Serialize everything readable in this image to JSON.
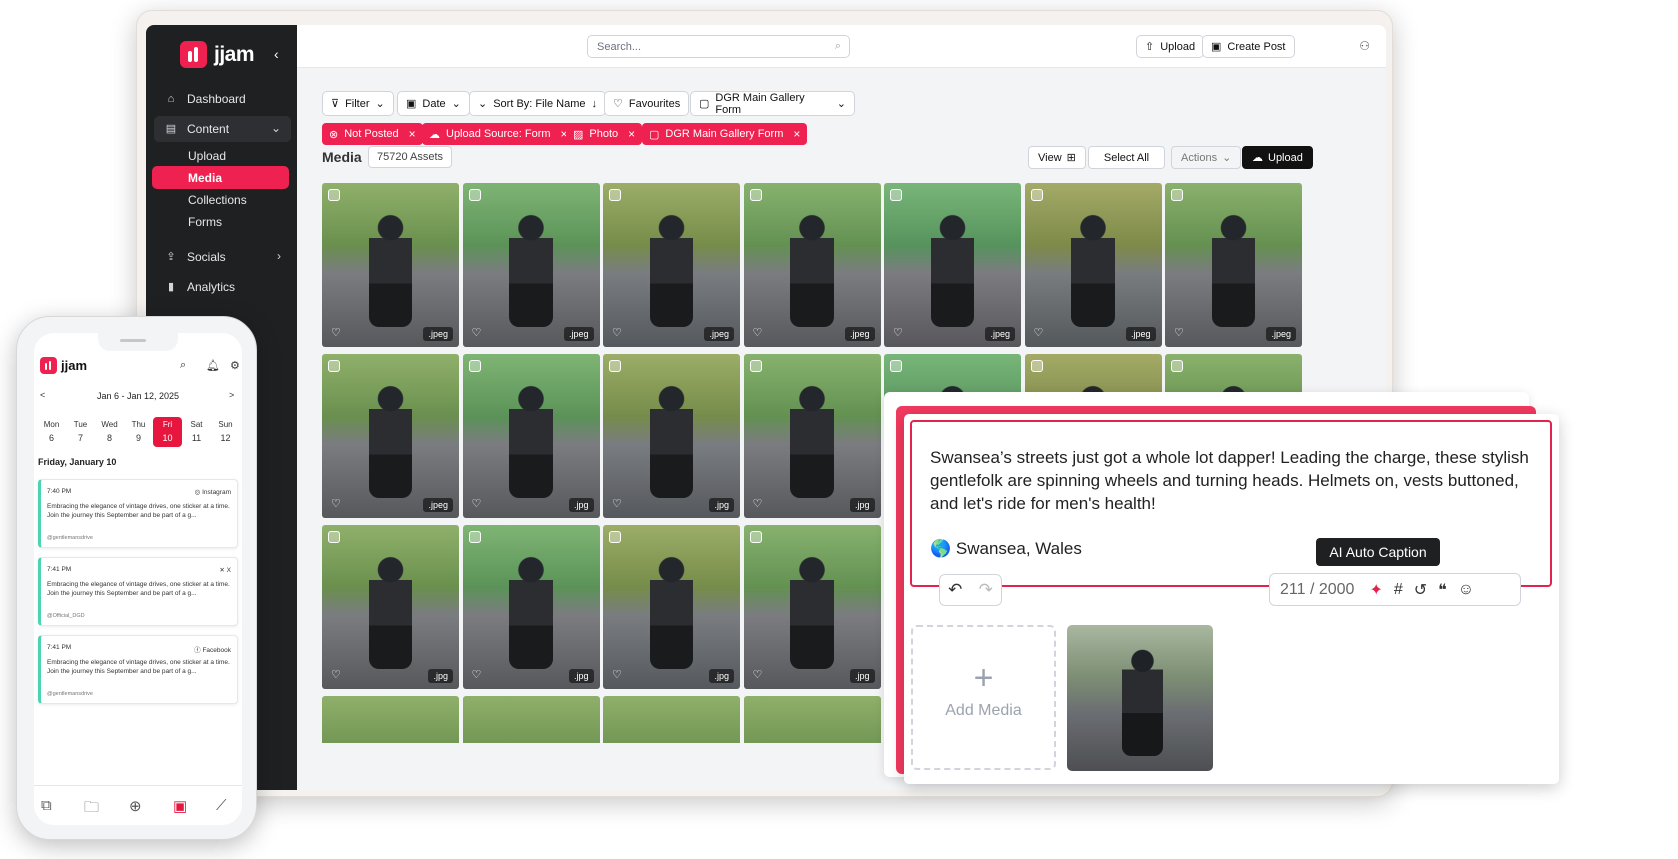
{
  "app": {
    "name": "jjam"
  },
  "sidebar": {
    "items": [
      {
        "label": "Dashboard",
        "icon": "home-icon"
      },
      {
        "label": "Content",
        "icon": "content-icon"
      },
      {
        "label": "Socials",
        "icon": "share-icon"
      },
      {
        "label": "Analytics",
        "icon": "bar-chart-icon"
      }
    ],
    "content_sub": [
      "Upload",
      "Media",
      "Collections",
      "Forms"
    ],
    "active": "Media"
  },
  "topbar": {
    "search_placeholder": "Search...",
    "upload": "Upload",
    "create_post": "Create Post"
  },
  "filters": {
    "filter": "Filter",
    "date": "Date",
    "sort": "Sort By: File Name",
    "favourites": "Favourites",
    "form": "DGR Main Gallery Form"
  },
  "chips": [
    "Not Posted",
    "Upload Source: Form",
    "Photo",
    "DGR Main Gallery Form"
  ],
  "media": {
    "title": "Media",
    "assets": "75720 Assets",
    "view": "View",
    "select_all": "Select All",
    "actions": "Actions",
    "upload": "Upload",
    "tiles": [
      {
        "ext": ".jpeg"
      },
      {
        "ext": ".jpeg"
      },
      {
        "ext": ".jpeg"
      },
      {
        "ext": ".jpeg"
      },
      {
        "ext": ".jpeg"
      },
      {
        "ext": ".jpeg"
      },
      {
        "ext": ".jpeg"
      },
      {
        "ext": ".jpeg"
      },
      {
        "ext": ".jpg"
      },
      {
        "ext": ".jpg"
      },
      {
        "ext": ".jpg"
      },
      {
        "ext": ""
      },
      {
        "ext": ""
      },
      {
        "ext": ""
      },
      {
        "ext": ".jpg"
      },
      {
        "ext": ".jpg"
      },
      {
        "ext": ".jpg"
      },
      {
        "ext": ".jpg"
      },
      {
        "ext": ""
      }
    ]
  },
  "phone": {
    "range": "Jan 6 - Jan 12, 2025",
    "prev": "<",
    "next": ">",
    "days": [
      {
        "d": "Mon",
        "n": "6"
      },
      {
        "d": "Tue",
        "n": "7"
      },
      {
        "d": "Wed",
        "n": "8"
      },
      {
        "d": "Thu",
        "n": "9"
      },
      {
        "d": "Fri",
        "n": "10"
      },
      {
        "d": "Sat",
        "n": "11"
      },
      {
        "d": "Sun",
        "n": "12"
      }
    ],
    "date_heading": "Friday, January 10",
    "posts": [
      {
        "time": "7:40 PM",
        "network": "Instagram",
        "text": "Embracing the elegance of vintage drives, one sticker at a time. Join the journey this September and be part of a g...",
        "handle": "@gentlemansdrive"
      },
      {
        "time": "7:41 PM",
        "network": "X",
        "text": "Embracing the elegance of vintage drives, one sticker at a time. Join the journey this September and be part of a g...",
        "handle": "@Official_DGD"
      },
      {
        "time": "7:41 PM",
        "network": "Facebook",
        "text": "Embracing the elegance of vintage drives, one sticker at a time. Join the journey this September and be part of a g...",
        "handle": "@gentlemansdrive"
      }
    ]
  },
  "composer": {
    "text": "Swansea’s streets just got a whole lot dapper! Leading the charge, these stylish gentlefolk are spinning wheels and turning heads. Helmets on, vests buttoned, and let's ride for men's health!",
    "location": "🌎 Swansea, Wales",
    "count": "211 / 2000",
    "tooltip": "AI Auto Caption",
    "add_media": "Add Media"
  },
  "colors": {
    "brand": "#ee2150",
    "sidebar": "#1f2022",
    "card_accent": "#4ad4b1"
  }
}
